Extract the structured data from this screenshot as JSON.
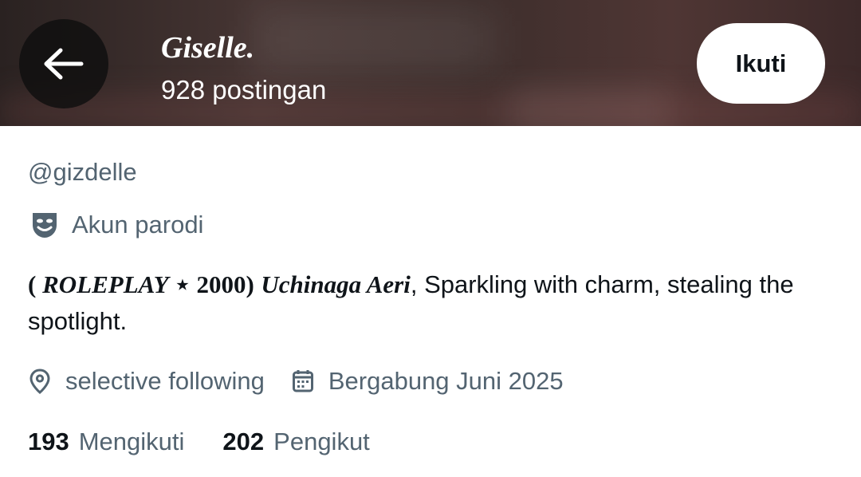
{
  "header": {
    "title": "Giselle.",
    "post_count": "928 postingan",
    "follow_label": "Ikuti"
  },
  "profile": {
    "handle": "@gizdelle",
    "label": "Akun parodi",
    "bio": {
      "paren_open": "( ",
      "roleplay": "ROLEPLAY",
      "star": " ⋆ ",
      "year_close": " 2000)",
      "name": "Uchinaga Aeri",
      "rest": ", Sparkling with charm, stealing the spotlight."
    },
    "location": "selective following",
    "joined": "Bergabung Juni 2025",
    "following_count": "193",
    "following_label": "Mengikuti",
    "followers_count": "202",
    "followers_label": "Pengikut"
  },
  "icons": {
    "back": "arrow-left-icon",
    "parody": "theater-mask-icon",
    "location": "location-pin-icon",
    "calendar": "calendar-icon"
  },
  "colors": {
    "text_primary": "#0f1419",
    "text_secondary": "#536471",
    "button_bg": "#ffffff"
  }
}
